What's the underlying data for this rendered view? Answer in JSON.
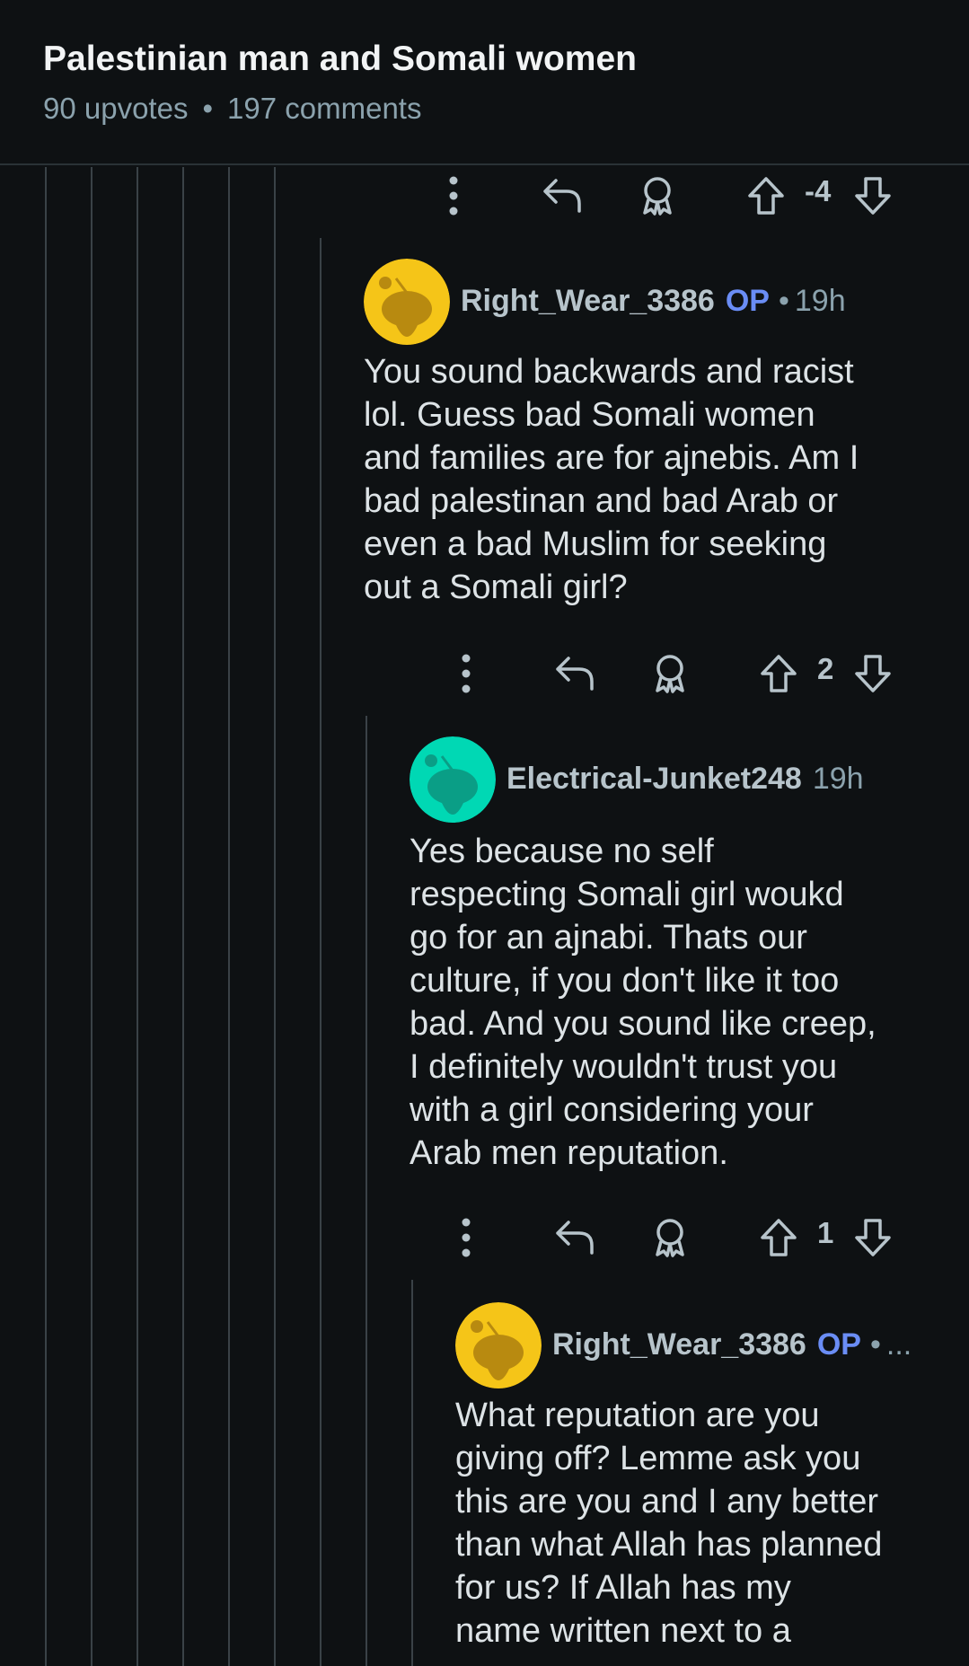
{
  "post": {
    "title": "Palestinian man and Somali women",
    "upvotes": "90 upvotes",
    "separator": "•",
    "comments": "197 comments"
  },
  "actions": [
    {
      "score": "-4"
    },
    {
      "score": "2"
    },
    {
      "score": "1"
    }
  ],
  "comments": [
    {
      "author": "Right_Wear_3386",
      "op_badge": "OP",
      "separator": "•",
      "time": "19h",
      "avatar_color": "#f5c518",
      "body_lines": [
        "You sound backwards and racist",
        "lol. Guess bad Somali women",
        "and families are for ajnebis. Am I",
        "bad palestinan and bad Arab or",
        "even a bad Muslim for seeking",
        "out a Somali girl?"
      ]
    },
    {
      "author": "Electrical-Junket248",
      "time": "19h",
      "avatar_color": "#00d8b4",
      "body_lines": [
        "Yes because no self",
        "respecting Somali girl woukd",
        "go for an ajnabi. Thats our",
        "culture, if you don't like it too",
        "bad. And you sound like creep,",
        "I definitely wouldn't trust you",
        "with a girl considering your",
        "Arab men reputation."
      ]
    },
    {
      "author": "Right_Wear_3386",
      "op_badge": "OP",
      "separator": "•",
      "time": "...",
      "avatar_color": "#f5c518",
      "body_lines": [
        "What reputation are you",
        "giving off? Lemme ask you",
        "this are you and I any better",
        "than what Allah has planned",
        "for us? If Allah has my",
        "name written next to a"
      ]
    }
  ],
  "colors": {
    "background": "#0e1113",
    "op_badge": "#6a8df5",
    "thread_line": "#3a4247"
  },
  "icons": [
    "more-options-icon",
    "reply-icon",
    "award-icon",
    "upvote-icon",
    "downvote-icon",
    "snoo-avatar-icon"
  ]
}
